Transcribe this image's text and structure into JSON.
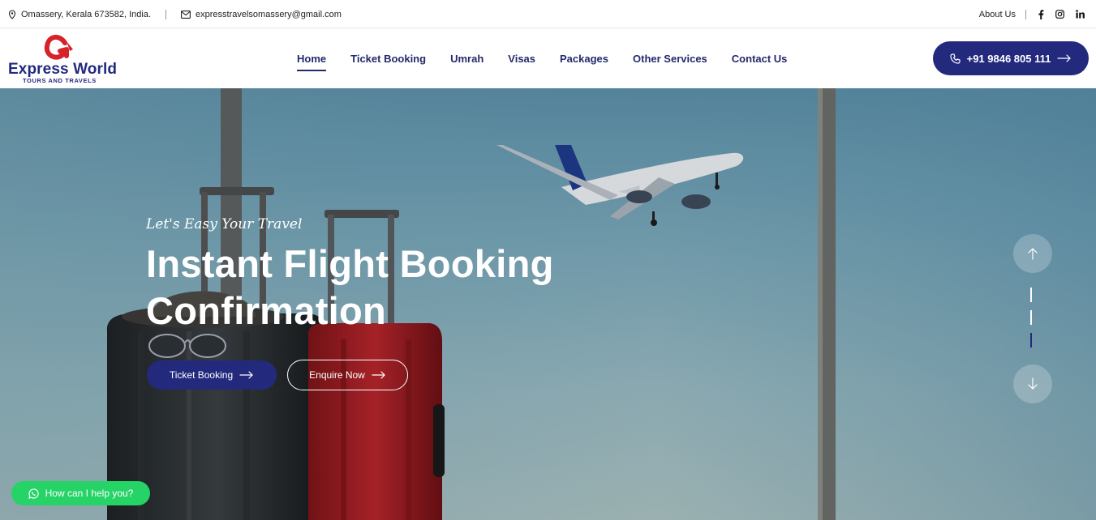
{
  "topbar": {
    "address": "Omassery, Kerala 673582, India.",
    "email": "expresstravelsomassery@gmail.com",
    "about": "About Us",
    "social": [
      "facebook-icon",
      "instagram-icon",
      "linkedin-icon"
    ]
  },
  "brand": {
    "logo_letter": "G",
    "name": "Express World",
    "sub": "TOURS AND TRAVELS",
    "colors": {
      "navy": "#232a7e",
      "red": "#d6232a"
    }
  },
  "nav": {
    "items": [
      {
        "label": "Home",
        "active": true
      },
      {
        "label": "Ticket Booking"
      },
      {
        "label": "Umrah"
      },
      {
        "label": "Visas"
      },
      {
        "label": "Packages"
      },
      {
        "label": "Other Services"
      },
      {
        "label": "Contact Us"
      }
    ],
    "phone": "+91 9846 805 111"
  },
  "hero": {
    "tagline": "Let's Easy Your Travel",
    "title_line1": "Instant Flight Booking",
    "title_line2": "Confirmation",
    "primary_button": "Ticket Booking",
    "secondary_button": "Enquire Now",
    "slides_total": 3,
    "active_slide": 3
  },
  "chat": {
    "label": "How can I help you?"
  }
}
